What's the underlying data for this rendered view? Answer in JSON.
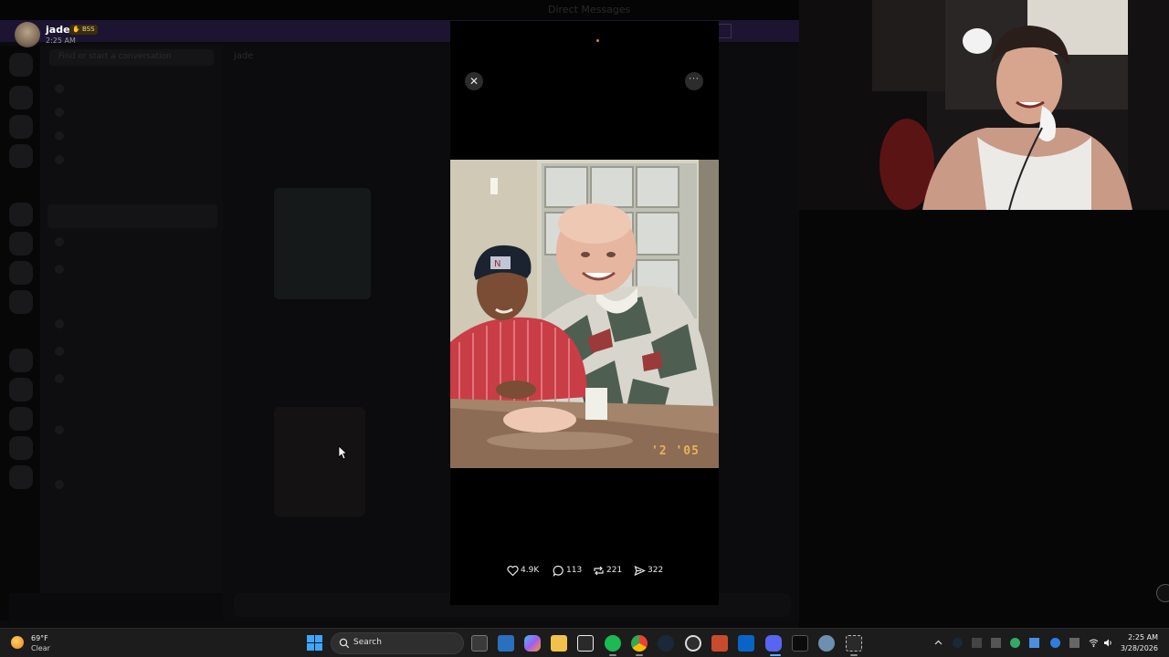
{
  "background_app": {
    "titlebar_text": "Direct Messages",
    "search_placeholder": "Find or start a conversation",
    "channel_header": "jade"
  },
  "notification": {
    "name": "jade",
    "badge": "BSS",
    "time": "2:25 AM"
  },
  "viewer": {
    "close_icon": "close-icon",
    "more_icon": "more-icon",
    "photo_date_stamp": "'2 '05",
    "stats": {
      "likes": "4.9K",
      "replies": "113",
      "reposts": "221",
      "shares": "322"
    }
  },
  "taskbar": {
    "weather": {
      "temp": "69°F",
      "condition": "Clear"
    },
    "search_label": "Search",
    "clock": {
      "time": "2:25 AM",
      "date": "3/28/2026"
    },
    "apps": [
      "task-view",
      "microsoft-store",
      "copilot",
      "file-explorer",
      "epic-games",
      "spotify",
      "chrome",
      "steam",
      "obs",
      "game-launcher",
      "outlook",
      "discord",
      "terminal",
      "settings",
      "snipping-tool"
    ]
  }
}
